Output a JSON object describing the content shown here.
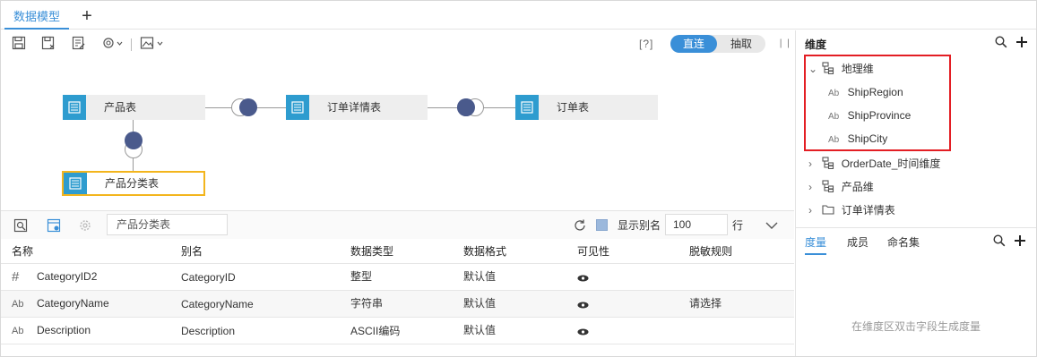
{
  "tabs": {
    "active_label": "数据模型",
    "add_icon": "plus-icon"
  },
  "toolbar": {
    "icons": [
      "save-icon",
      "save-as-icon",
      "edit-icon",
      "settings-dropdown-icon",
      "image-dropdown-icon"
    ],
    "help_label": "[?]",
    "mode_direct": "直连",
    "mode_extract": "抽取",
    "collapse_icon": "collapse-bars-icon"
  },
  "canvas": {
    "tables": [
      {
        "name": "产品表"
      },
      {
        "name": "订单详情表"
      },
      {
        "name": "订单表"
      },
      {
        "name": "产品分类表"
      }
    ]
  },
  "bottom_bar": {
    "search_value": "产品分类表",
    "show_alias_label": "显示别名",
    "row_count": "100",
    "row_unit": "行"
  },
  "table": {
    "headers": [
      "名称",
      "别名",
      "数据类型",
      "数据格式",
      "可见性",
      "脱敏规则"
    ],
    "rows": [
      {
        "icon": "#",
        "name": "CategoryID2",
        "alias": "CategoryID",
        "type": "整型",
        "format": "默认值",
        "mask": ""
      },
      {
        "icon": "Ab",
        "name": "CategoryName",
        "alias": "CategoryName",
        "type": "字符串",
        "format": "默认值",
        "mask": "请选择"
      },
      {
        "icon": "Ab",
        "name": "Description",
        "alias": "Description",
        "type": "ASCII编码",
        "format": "默认值",
        "mask": ""
      }
    ]
  },
  "right_panel": {
    "title": "维度",
    "tree": [
      {
        "label": "地理维",
        "expanded": true,
        "children": [
          "ShipRegion",
          "ShipProvince",
          "ShipCity"
        ]
      },
      {
        "label": "OrderDate_时间维度",
        "expanded": false
      },
      {
        "label": "产品维",
        "expanded": false
      },
      {
        "label": "订单详情表",
        "expanded": false
      }
    ],
    "tabs": [
      "度量",
      "成员",
      "命名集"
    ],
    "hint": "在维度区双击字段生成度量"
  },
  "colors": {
    "accent": "#3a8fd8",
    "node_icon": "#2e9ccf",
    "join_dot": "#4a5a8c",
    "highlight_box": "#e31e24",
    "selected_node": "#f3b51d"
  }
}
